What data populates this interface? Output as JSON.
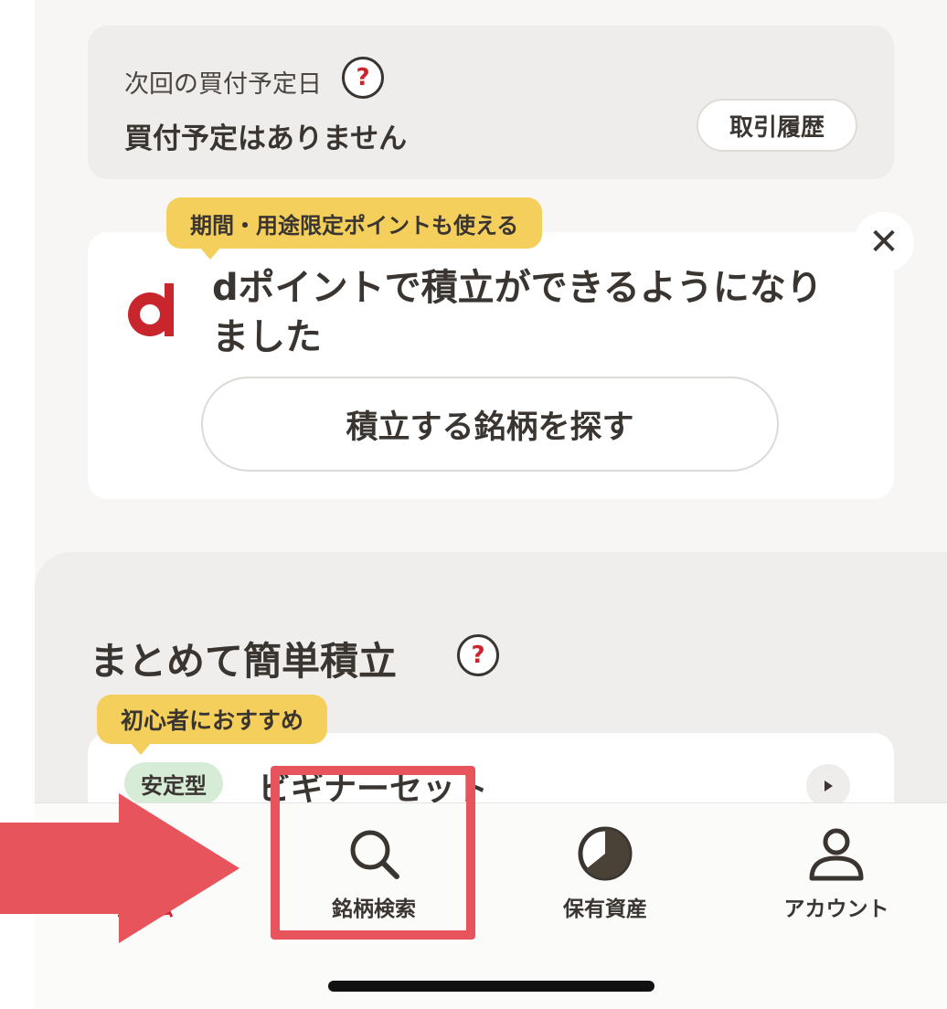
{
  "schedule": {
    "label": "次回の買付予定日",
    "value": "買付予定はありません",
    "help_glyph": "?",
    "history_button": "取引履歴"
  },
  "promo": {
    "tag": "期間・用途限定ポイントも使える",
    "title": "dポイントで積立ができるようになりました",
    "button": "積立する銘柄を探す",
    "close_glyph": "✕"
  },
  "bundle": {
    "title": "まとめて簡単積立",
    "help_glyph": "?",
    "beginner_tag": "初心者におすすめ",
    "item": {
      "badge": "安定型",
      "name": "ビギナーセット"
    }
  },
  "nav": {
    "items": [
      {
        "label": "ホーム",
        "icon": "home-icon"
      },
      {
        "label": "銘柄検索",
        "icon": "search-icon"
      },
      {
        "label": "保有資産",
        "icon": "pie-chart-icon"
      },
      {
        "label": "アカウント",
        "icon": "person-icon"
      }
    ]
  },
  "colors": {
    "accent_red": "#c8262c",
    "tag_yellow": "#f4cf5b",
    "highlight": "#e8545c",
    "badge_green": "#d6ecd7"
  }
}
